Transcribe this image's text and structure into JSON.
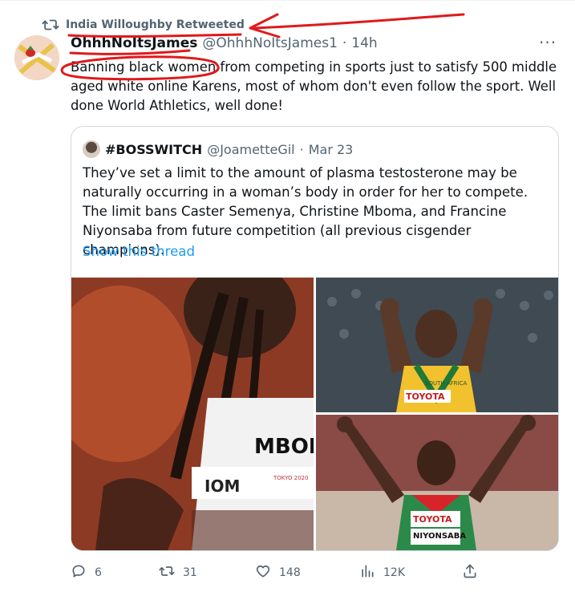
{
  "retweet": {
    "icon": "retweet-icon",
    "text": "India Willoughby Retweeted"
  },
  "tweet": {
    "name": "OhhhNoItsJames",
    "handle": "@OhhhNoItsJames1",
    "dot": "·",
    "time": "14h",
    "more": "···",
    "text": "Banning black women from competing in sports just to satisfy 500 middle aged white online Karens, most of whom don't even follow the sport. Well done World Athletics, well done!"
  },
  "quote": {
    "name": "#BOSSWITCH",
    "handle": "@JoametteGil",
    "dot": "·",
    "time": "Mar 23",
    "text": "They’ve set a limit to the amount of plasma testosterone may be naturally occurring in a woman’s body in order for her to compete. The limit bans Caster Semenya, Christine Mboma, and Francine Niyonsaba from future competition (all previous cisgender champions).",
    "show_thread": "Show this thread"
  },
  "media_labels": {
    "left_bib": "MBOM",
    "left_bib_lower": "IOM",
    "left_sponsor": "TOKYO 2020",
    "tr_sponsor": "TOYOTA",
    "tr_country": "SOUTH AFRICA",
    "br_sponsor": "TOYOTA",
    "br_bib": "NIYONSABA"
  },
  "actions": {
    "reply": {
      "icon": "reply-icon",
      "count": "6"
    },
    "retweet": {
      "icon": "retweet-icon",
      "count": "31"
    },
    "like": {
      "icon": "heart-icon",
      "count": "148"
    },
    "views": {
      "icon": "views-icon",
      "count": "12K"
    },
    "share": {
      "icon": "share-icon"
    }
  },
  "colors": {
    "annotation": "#e0191b",
    "link": "#1d9bf0",
    "muted": "#536471"
  }
}
